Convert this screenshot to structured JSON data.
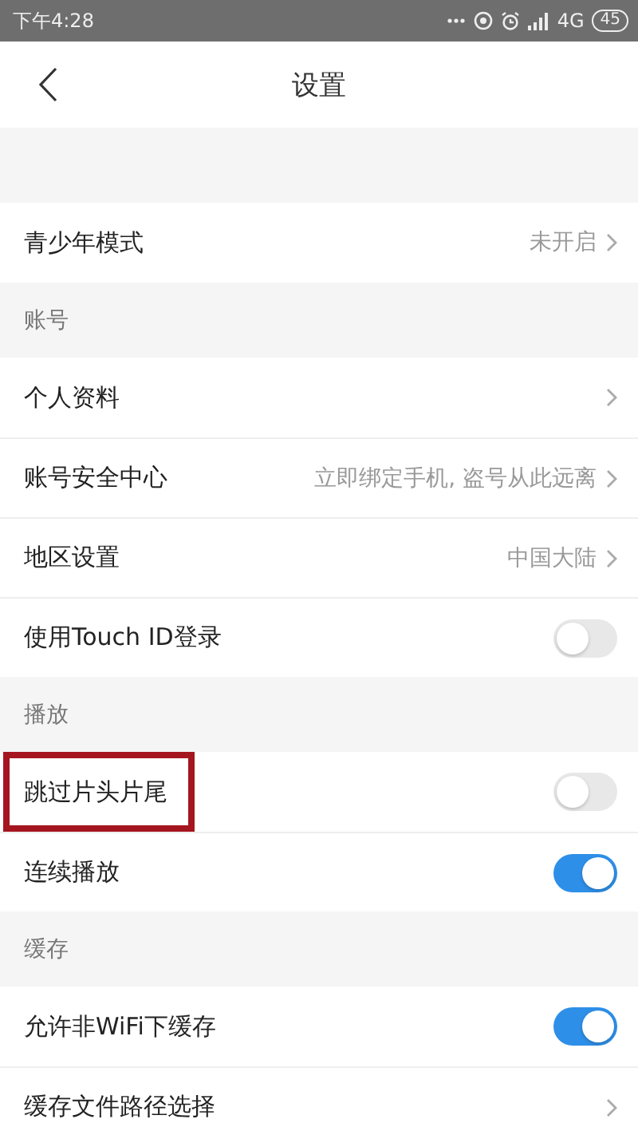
{
  "status_bar": {
    "time": "下午4:28",
    "network": "4G",
    "battery": "45"
  },
  "header": {
    "title": "设置"
  },
  "sections": [
    {
      "items": [
        {
          "kind": "link",
          "label": "青少年模式",
          "value": "未开启"
        }
      ]
    },
    {
      "title": "账号",
      "items": [
        {
          "kind": "link",
          "label": "个人资料"
        },
        {
          "kind": "link",
          "label": "账号安全中心",
          "value": "立即绑定手机, 盗号从此远离"
        },
        {
          "kind": "link",
          "label": "地区设置",
          "value": "中国大陆"
        },
        {
          "kind": "toggle",
          "label": "使用Touch ID登录",
          "on": false
        }
      ]
    },
    {
      "title": "播放",
      "items": [
        {
          "kind": "toggle",
          "label": "跳过片头片尾",
          "on": false,
          "highlighted": true
        },
        {
          "kind": "toggle",
          "label": "连续播放",
          "on": true
        }
      ]
    },
    {
      "title": "缓存",
      "items": [
        {
          "kind": "toggle",
          "label": "允许非WiFi下缓存",
          "on": true
        },
        {
          "kind": "link",
          "label": "缓存文件路径选择"
        }
      ]
    }
  ]
}
